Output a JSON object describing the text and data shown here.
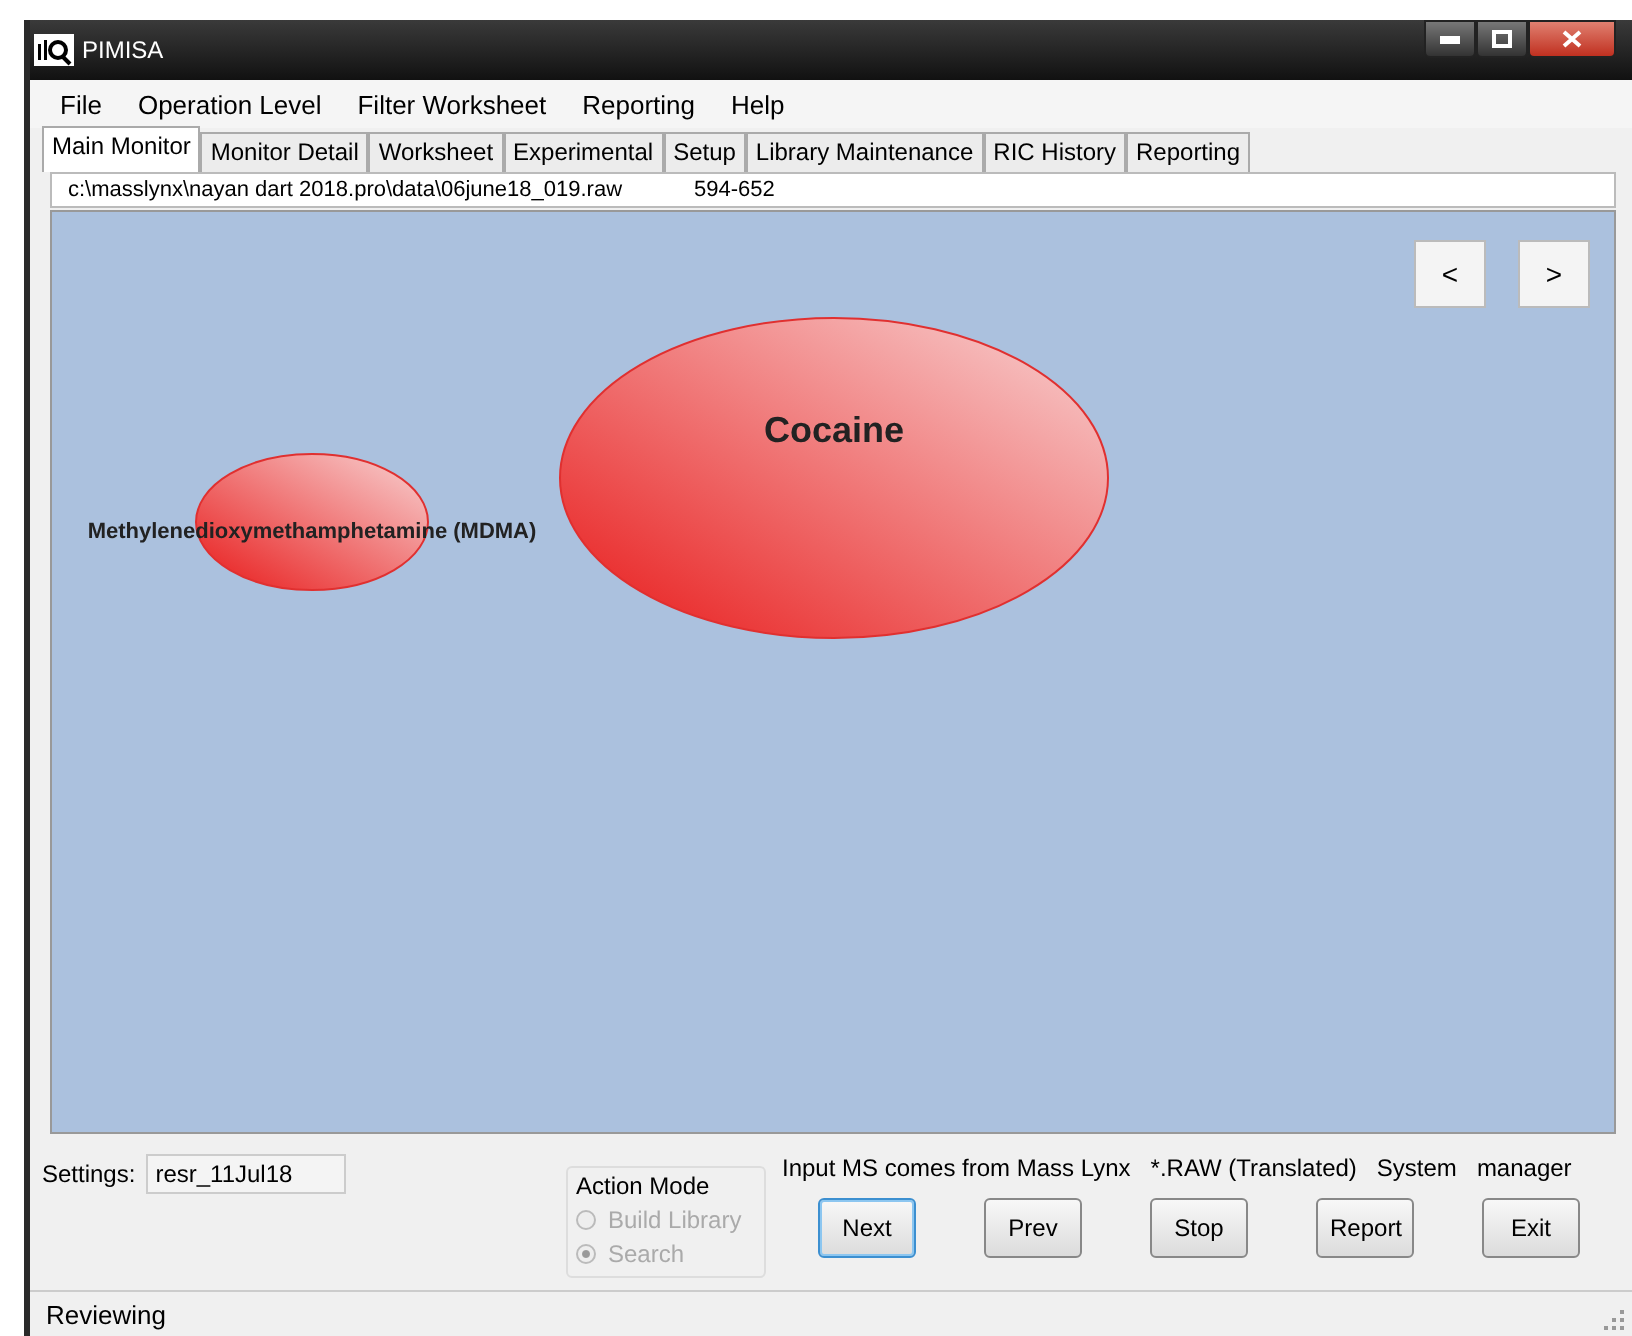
{
  "window": {
    "title": "PIMISA"
  },
  "menu": [
    "File",
    "Operation Level",
    "Filter Worksheet",
    "Reporting",
    "Help"
  ],
  "tabs": [
    {
      "label": "Main Monitor",
      "selected": true
    },
    {
      "label": "Monitor Detail",
      "selected": false
    },
    {
      "label": "Worksheet",
      "selected": false
    },
    {
      "label": "Experimental",
      "selected": false
    },
    {
      "label": "Setup",
      "selected": false
    },
    {
      "label": "Library Maintenance",
      "selected": false
    },
    {
      "label": "RIC History",
      "selected": false
    },
    {
      "label": "Reporting",
      "selected": false
    }
  ],
  "file_path": "c:\\masslynx\\nayan dart 2018.pro\\data\\06june18_019.raw",
  "scan_range": "594-652",
  "nav_buttons": [
    "<",
    ">"
  ],
  "bubbles": [
    {
      "label": "Methylenedioxymethamphetamine (MDMA)",
      "kind": "small"
    },
    {
      "label": "Cocaine",
      "kind": "large"
    }
  ],
  "settings": {
    "label": "Settings:",
    "value": "resr_11Jul18"
  },
  "action_mode": {
    "title": "Action Mode",
    "disabled": true,
    "options": [
      {
        "label": "Build Library",
        "selected": false
      },
      {
        "label": "Search",
        "selected": true
      }
    ]
  },
  "info": [
    "Input MS comes from Mass Lynx",
    "*.RAW (Translated)",
    "System",
    "manager"
  ],
  "buttons": [
    {
      "label": "Next",
      "focused": true
    },
    {
      "label": "Prev",
      "focused": false
    },
    {
      "label": "Stop",
      "focused": false
    },
    {
      "label": "Report",
      "focused": false
    },
    {
      "label": "Exit",
      "focused": false
    }
  ],
  "status_bar": "Reviewing"
}
